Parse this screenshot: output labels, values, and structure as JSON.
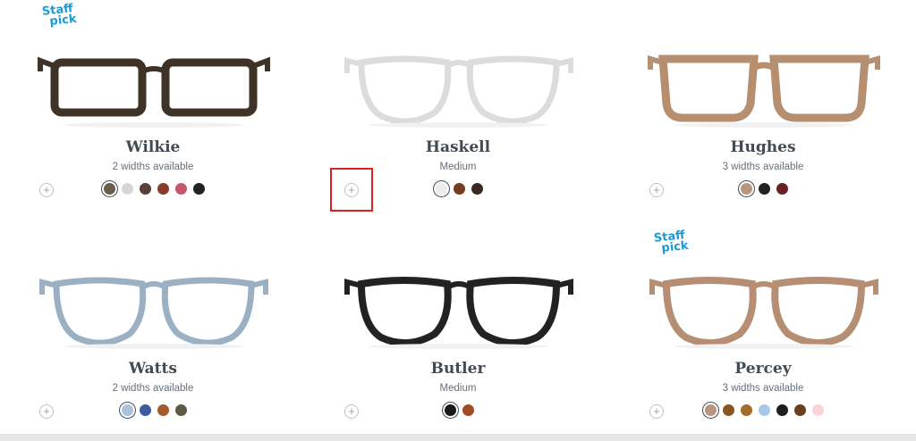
{
  "products": [
    {
      "name": "Wilkie",
      "subtitle": "2 widths available",
      "staff_pick": true,
      "frame": "rect-dark",
      "swatches": [
        "#6b5f4c",
        "#d6d6d6",
        "#5a3f38",
        "#8a3b2a",
        "#c4576a",
        "#222222"
      ],
      "selected": 0
    },
    {
      "name": "Haskell",
      "subtitle": "Medium",
      "staff_pick": false,
      "frame": "round-clear",
      "swatches": [
        "#ececec",
        "#7a3a1e",
        "#3a2a22"
      ],
      "selected": 0
    },
    {
      "name": "Hughes",
      "subtitle": "3 widths available",
      "staff_pick": false,
      "frame": "square-tan",
      "swatches": [
        "#b8957d",
        "#222222",
        "#6a2126"
      ],
      "selected": 0
    },
    {
      "name": "Watts",
      "subtitle": "2 widths available",
      "staff_pick": false,
      "frame": "round-blue",
      "swatches": [
        "#a9c3dc",
        "#3c5aa0",
        "#a65b2c",
        "#5d5a44"
      ],
      "selected": 0
    },
    {
      "name": "Butler",
      "subtitle": "Medium",
      "staff_pick": false,
      "frame": "round-black",
      "swatches": [
        "#1a1a1a",
        "#a24b1f"
      ],
      "selected": 0
    },
    {
      "name": "Percey",
      "subtitle": "3 widths available",
      "staff_pick": true,
      "frame": "round-tan",
      "swatches": [
        "#b99680",
        "#8a5324",
        "#a5692c",
        "#a8c8e8",
        "#1f1f1f",
        "#6a4020",
        "#f6d4d8"
      ],
      "selected": 0
    }
  ],
  "badge": {
    "line1": "Staff",
    "line2": "pick"
  },
  "add_button_glyph": "+",
  "colors": {
    "accent": "#1d9ad6",
    "highlight": "#e02020",
    "text": "#414b56"
  }
}
